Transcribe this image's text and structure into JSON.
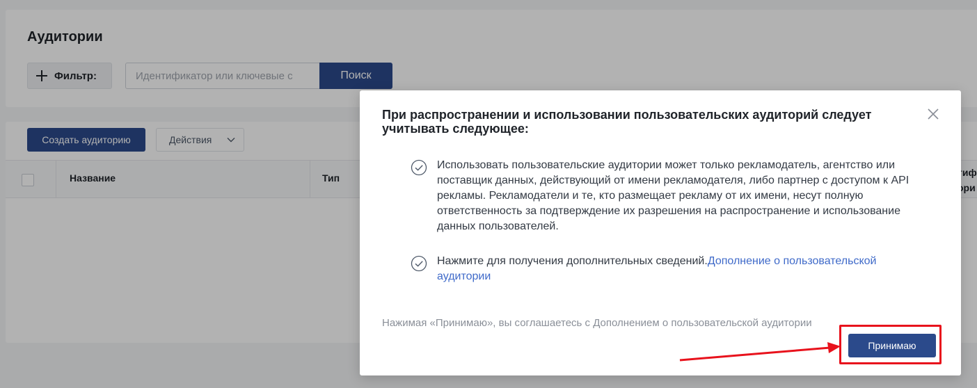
{
  "page": {
    "title": "Аудитории",
    "filter_label": "Фильтр:",
    "search_placeholder": "Идентификатор или ключевые с",
    "search_button": "Поиск",
    "create_button": "Создать аудиторию",
    "actions_button": "Действия",
    "table": {
      "columns": [
        "Название",
        "Тип"
      ],
      "partial_column": "тиф\nори"
    }
  },
  "modal": {
    "title": "При распространении и использовании пользовательских аудиторий следует учитывать следующее:",
    "items": [
      {
        "text": "Использовать пользовательские аудитории может только рекламодатель, агентство или поставщик данных, действующий от имени рекламодателя, либо партнер с доступом к API рекламы. Рекламодатели и те, кто размещает рекламу от их имени, несут полную ответственность за подтверждение их разрешения на распространение и использование данных пользователей."
      },
      {
        "text": "Нажмите для получения дополнительных сведений.",
        "link": "Дополнение о пользовательской аудитории"
      }
    ],
    "footnote": "Нажимая «Принимаю», вы соглашаетесь с Дополнением о пользовательской аудитории",
    "accept_button": "Принимаю"
  },
  "icons": {
    "filter": "plus-icon",
    "actions": "chevron-down-icon",
    "item": "check-circle-icon",
    "close": "close-icon"
  },
  "colors": {
    "primary": "#2b4a8b",
    "link": "#3f6ac9",
    "annotation": "#e8121c"
  }
}
